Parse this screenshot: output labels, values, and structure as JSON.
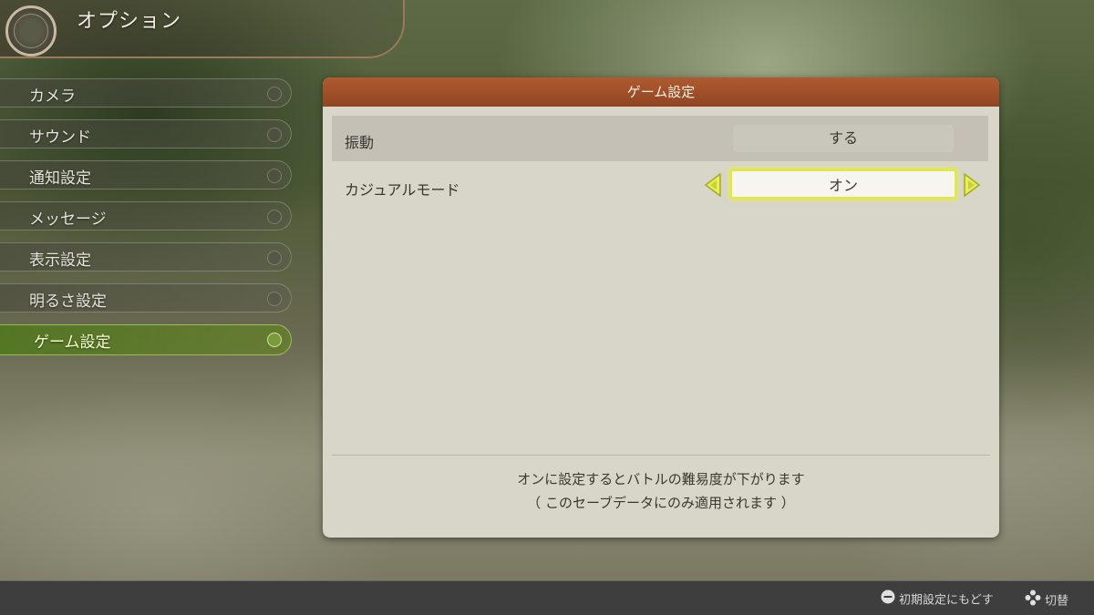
{
  "header": {
    "title": "オプション"
  },
  "sidebar": {
    "items": [
      {
        "label": "カメラ"
      },
      {
        "label": "サウンド"
      },
      {
        "label": "通知設定"
      },
      {
        "label": "メッセージ"
      },
      {
        "label": "表示設定"
      },
      {
        "label": "明るさ設定"
      },
      {
        "label": "ゲーム設定",
        "active": true
      }
    ]
  },
  "panel": {
    "title": "ゲーム設定",
    "settings": [
      {
        "label": "振動",
        "value": "する"
      },
      {
        "label": "カジュアルモード",
        "value": "オン"
      }
    ],
    "description": {
      "line1": "オンに設定するとバトルの難易度が下がります",
      "line2": "（ このセーブデータにのみ適用されます ）"
    }
  },
  "footer": {
    "reset_hint": "初期設定にもどす",
    "switch_hint": "切替"
  },
  "colors": {
    "accent_header": "#a0512a",
    "selection_glow": "#e3e84a",
    "active_menu": "#6a8a30"
  },
  "icons": {
    "left_arrow": "triangle-left",
    "right_arrow": "triangle-right",
    "reset": "minus-button",
    "switch": "dpad"
  }
}
